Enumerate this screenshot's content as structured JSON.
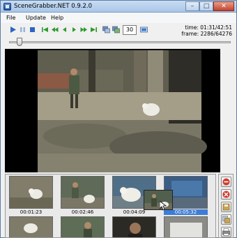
{
  "window": {
    "title": "SceneGrabber.NET 0.9.2.0",
    "controls": {
      "minimize": "–",
      "maximize": "□",
      "close": "✕"
    }
  },
  "menu": [
    "File",
    "Update",
    "Help"
  ],
  "toolbar": {
    "buttons": [
      "play-icon",
      "pause-icon",
      "stop-icon",
      "skip-start-icon",
      "fast-rewind-icon",
      "step-back-icon",
      "step-forward-icon",
      "fast-forward-icon",
      "skip-end-icon",
      "grab-frames-icon",
      "grab-auto-icon",
      "preview-icon"
    ],
    "frame_count": "30",
    "time_label": "time: 01:31/42:51",
    "frame_label": "frame: 2286/64276"
  },
  "seek": {
    "position": 0.036
  },
  "thumbnails": [
    {
      "time": "00:01:23",
      "selected": false
    },
    {
      "time": "00:02:46",
      "selected": false
    },
    {
      "time": "00:04:09",
      "selected": false
    },
    {
      "time": "00:05:32",
      "selected": true
    }
  ],
  "side_buttons": [
    "remove-icon",
    "remove-all-icon",
    "save-icon",
    "save-all-icon",
    "print-icon"
  ],
  "colors": {
    "accent": "#3d7dd6",
    "titlebar": "#b9d1ec",
    "danger": "#d23a2c"
  }
}
